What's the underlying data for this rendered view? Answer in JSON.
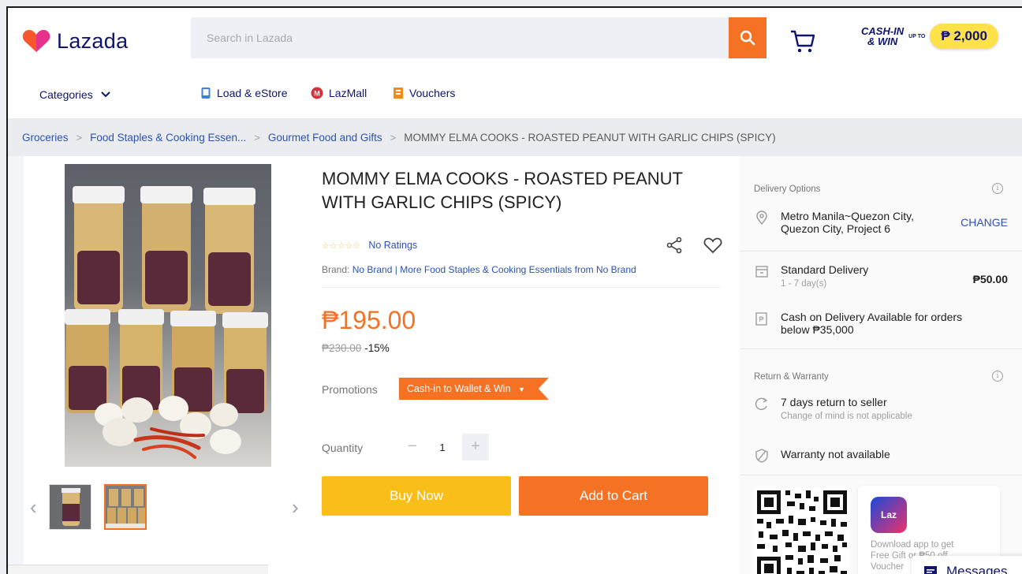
{
  "header": {
    "logo_text": "Lazada",
    "search_placeholder": "Search in Lazada",
    "cashin_line1": "CASH-IN",
    "cashin_line2": "& WIN",
    "cashin_upto": "UP TO",
    "cashin_amount": "₱ 2,000"
  },
  "nav": {
    "categories": "Categories",
    "links": [
      {
        "label": "Load & eStore",
        "icon": "phone-icon"
      },
      {
        "label": "LazMall",
        "icon": "lazmall-icon"
      },
      {
        "label": "Vouchers",
        "icon": "voucher-icon"
      }
    ]
  },
  "breadcrumb": [
    "Groceries",
    "Food Staples & Cooking Essen...",
    "Gourmet Food and Gifts",
    "MOMMY ELMA COOKS - ROASTED PEANUT WITH GARLIC CHIPS (SPICY)"
  ],
  "product": {
    "title": "MOMMY ELMA COOKS - ROASTED PEANUT WITH GARLIC CHIPS (SPICY)",
    "stars": "☆☆☆☆☆",
    "ratings_text": "No Ratings",
    "brand_label": "Brand:",
    "brand_name": "No Brand",
    "brand_more": "| More Food Staples & Cooking Essentials from No Brand",
    "price": "₱195.00",
    "original_price": "₱230.00",
    "discount": "-15%",
    "promotions_label": "Promotions",
    "promo_tag": "Cash-in to Wallet & Win",
    "quantity_label": "Quantity",
    "quantity_value": "1",
    "buy_now": "Buy Now",
    "add_to_cart": "Add to Cart"
  },
  "delivery": {
    "heading": "Delivery Options",
    "location": "Metro Manila~Quezon City, Quezon City, Project 6",
    "change": "CHANGE",
    "standard_title": "Standard Delivery",
    "standard_days": "1 - 7 day(s)",
    "standard_fee": "₱50.00",
    "cod": "Cash on Delivery Available for orders below ₱35,000"
  },
  "warranty": {
    "heading": "Return & Warranty",
    "return_title": "7 days return to seller",
    "return_sub": "Change of mind is not applicable",
    "warranty_text": "Warranty not available"
  },
  "app_promo": {
    "icon_text": "Laz",
    "text": "Download app to get Free Gift or ₱50 off Voucher"
  },
  "messages": "Messages",
  "colors": {
    "accent": "#f57224",
    "buy": "#fabe1a",
    "link": "#2b52b4",
    "brand": "#0f146d"
  }
}
